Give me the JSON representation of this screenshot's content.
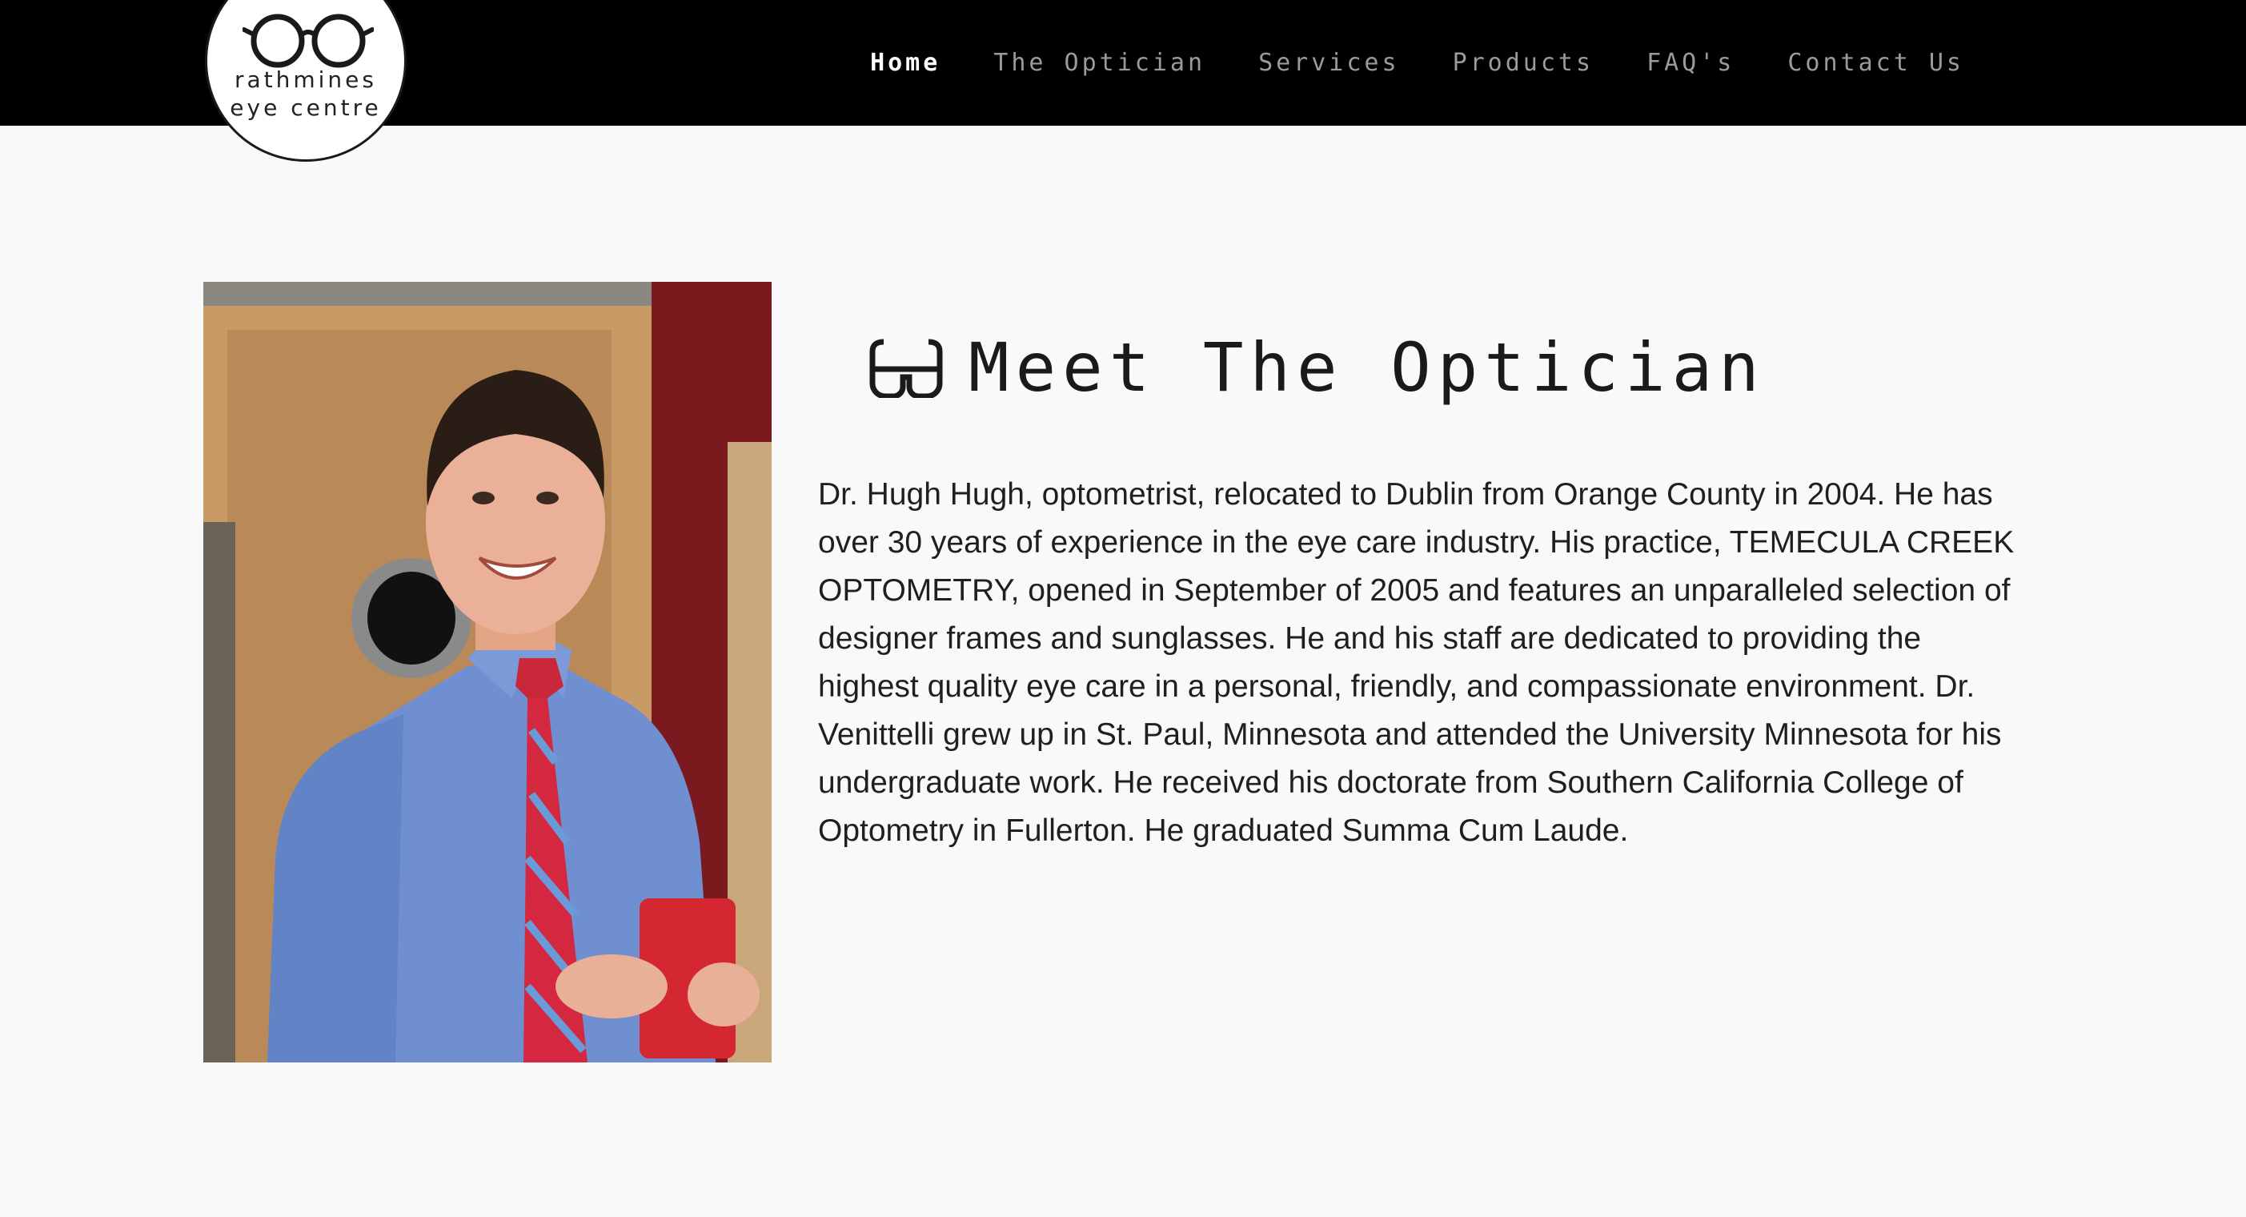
{
  "logo": {
    "line1": "rathmines",
    "line2": "eye centre",
    "icon": "glasses-icon"
  },
  "nav": {
    "items": [
      {
        "label": "Home",
        "active": true
      },
      {
        "label": "The Optician",
        "active": false
      },
      {
        "label": "Services",
        "active": false
      },
      {
        "label": "Products",
        "active": false
      },
      {
        "label": "FAQ's",
        "active": false
      },
      {
        "label": "Contact Us",
        "active": false
      }
    ]
  },
  "main": {
    "heading_icon": "glasses-icon",
    "heading": "Meet The Optician",
    "bio": "Dr. Hugh Hugh, optometrist, relocated to Dublin from Orange County in 2004. He has over 30 years of experience in the eye care industry. His practice, TEMECULA CREEK OPTOMETRY, opened in September of 2005 and features an unparalleled selection of designer frames and sunglasses. He and his staff are dedicated to providing the highest quality eye care in a personal, friendly, and compassionate environment. Dr. Venittelli grew up in St. Paul, Minnesota and attended the University Minnesota for his undergraduate work. He received his doctorate from Southern California College of Optometry in Fullerton. He graduated Summa Cum Laude."
  },
  "colors": {
    "header_bg": "#000000",
    "nav_active": "#ffffff",
    "nav_inactive": "#9b9b9b",
    "page_bg": "#f9f9f9",
    "text": "#1f1f1f"
  }
}
